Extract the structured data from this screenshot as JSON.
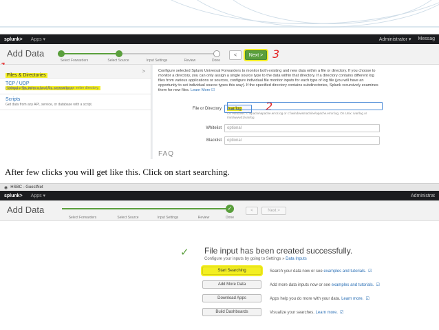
{
  "shot1": {
    "topbar": {
      "logo": "splunk>",
      "apps": "Apps ▾",
      "user": "Administrator ▾",
      "messages": "Messag"
    },
    "title": "Add Data",
    "steps": [
      "Select Forwarders",
      "Select Source",
      "Input Settings",
      "Review",
      "Done"
    ],
    "prev_label": "<",
    "next_label": "Next >",
    "annotations": {
      "a1": "1",
      "a2": "2",
      "a3": "3"
    },
    "sources": [
      {
        "title": "Files & Directories",
        "desc": "Upload a file, index a local file, or monitor an entire directory."
      },
      {
        "title": "TCP / UDP",
        "desc": "Configure Splunk to listen on a network port."
      },
      {
        "title": "Scripts",
        "desc": "Get data from any API, service, or database with a script."
      }
    ],
    "description": "Configure selected Splunk Universal Forwarders to monitor both existing and new data within a file or directory. If you choose to monitor a directory, you can only assign a single source type to the data within that directory. If a directory contains different log files from various applications or sources, configure individual file monitor inputs for each type of log file (you will have an opportunity to set individual source types this way). If the specified directory contains subdirectories, Splunk recursively examines them for new files.",
    "learn_more": "Learn More ☑",
    "fields": {
      "file_label": "File or Directory",
      "file_value": "/var/log",
      "file_help": "On Windows: c:\\apache\\apache.error.log or c:\\\\windowsmachine\\apache.error.log. On Unix: /var/log or /mnt/www01/var/log",
      "whitelist_label": "Whitelist",
      "whitelist_placeholder": "optional",
      "blacklist_label": "Blacklist",
      "blacklist_placeholder": "optional"
    },
    "faq": "FAQ"
  },
  "caption": "After few clicks you will get like this. Click on start searching.",
  "shot2": {
    "tab": "HSBC - GuestNet",
    "topbar": {
      "logo": "splunk>",
      "apps": "Apps ▾",
      "user": "Administrat"
    },
    "title": "Add Data",
    "steps": [
      "Select Forwarders",
      "Select Source",
      "Input Settings",
      "Review",
      "Done"
    ],
    "prev_label": "<",
    "next_label": "Next >",
    "success_title": "File input has been created successfully.",
    "success_sub": "Configure your inputs by going to Settings »",
    "success_sub_link": "Data Inputs",
    "actions": [
      {
        "label": "Start Searching",
        "text": "Search your data now or see",
        "link": "examples and tutorials.",
        "ext": "☑"
      },
      {
        "label": "Add More Data",
        "text": "Add more data inputs now or see",
        "link": "examples and tutorials.",
        "ext": "☑"
      },
      {
        "label": "Download Apps",
        "text": "Apps help you do more with your data.",
        "link": "Learn more.",
        "ext": "☑"
      },
      {
        "label": "Build Dashboards",
        "text": "Visualize your searches.",
        "link": "Learn more.",
        "ext": "☑"
      }
    ]
  }
}
